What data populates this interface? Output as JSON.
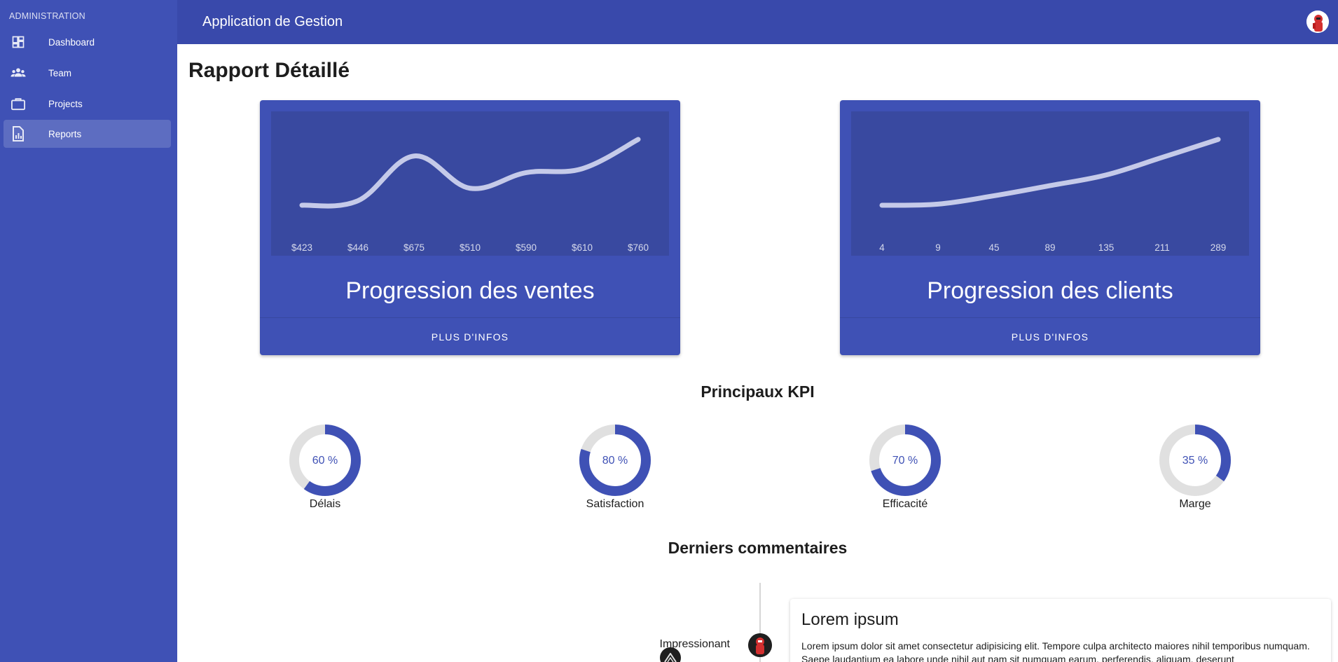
{
  "sidebar": {
    "header": "ADMINISTRATION",
    "items": [
      {
        "label": "Dashboard",
        "icon": "dashboard-icon"
      },
      {
        "label": "Team",
        "icon": "team-icon"
      },
      {
        "label": "Projects",
        "icon": "briefcase-icon"
      },
      {
        "label": "Reports",
        "icon": "report-icon",
        "active": true
      }
    ]
  },
  "appbar": {
    "title": "Application de Gestion"
  },
  "page": {
    "title": "Rapport Détaillé"
  },
  "cards": [
    {
      "title": "Progression des ventes",
      "button_label": "PLUS D'INFOS",
      "labels": [
        "$423",
        "$446",
        "$675",
        "$510",
        "$590",
        "$610",
        "$760"
      ]
    },
    {
      "title": "Progression des clients",
      "button_label": "PLUS D'INFOS",
      "labels": [
        "4",
        "9",
        "45",
        "89",
        "135",
        "211",
        "289"
      ]
    }
  ],
  "chart_data": [
    {
      "type": "line",
      "categories": [
        "$423",
        "$446",
        "$675",
        "$510",
        "$590",
        "$610",
        "$760"
      ],
      "values": [
        423,
        446,
        675,
        510,
        590,
        610,
        760
      ],
      "title": "Progression des ventes"
    },
    {
      "type": "line",
      "categories": [
        "4",
        "9",
        "45",
        "89",
        "135",
        "211",
        "289"
      ],
      "values": [
        4,
        9,
        45,
        89,
        135,
        211,
        289
      ],
      "title": "Progression des clients"
    }
  ],
  "kpi_section": {
    "title": "Principaux KPI",
    "items": [
      {
        "label": "Délais",
        "value_text": "60 %",
        "value": 60
      },
      {
        "label": "Satisfaction",
        "value_text": "80 %",
        "value": 80
      },
      {
        "label": "Efficacité",
        "value_text": "70 %",
        "value": 70
      },
      {
        "label": "Marge",
        "value_text": "35 %",
        "value": 35
      }
    ]
  },
  "comments_section": {
    "title": "Derniers commentaires",
    "items": [
      {
        "opposite": "Impressionant",
        "title": "Lorem ipsum",
        "text": "Lorem ipsum dolor sit amet consectetur adipisicing elit. Tempore culpa architecto maiores nihil temporibus numquam. Saepe laudantium ea labore unde nihil aut nam sit numquam earum, perferendis, aliquam, deserunt"
      }
    ]
  },
  "colors": {
    "primary": "#3f51b5",
    "appbar": "#3949ab",
    "chart_bg": "#3949a0",
    "chart_line": "#c5cae9",
    "kpi_track": "#e0e0e0"
  }
}
